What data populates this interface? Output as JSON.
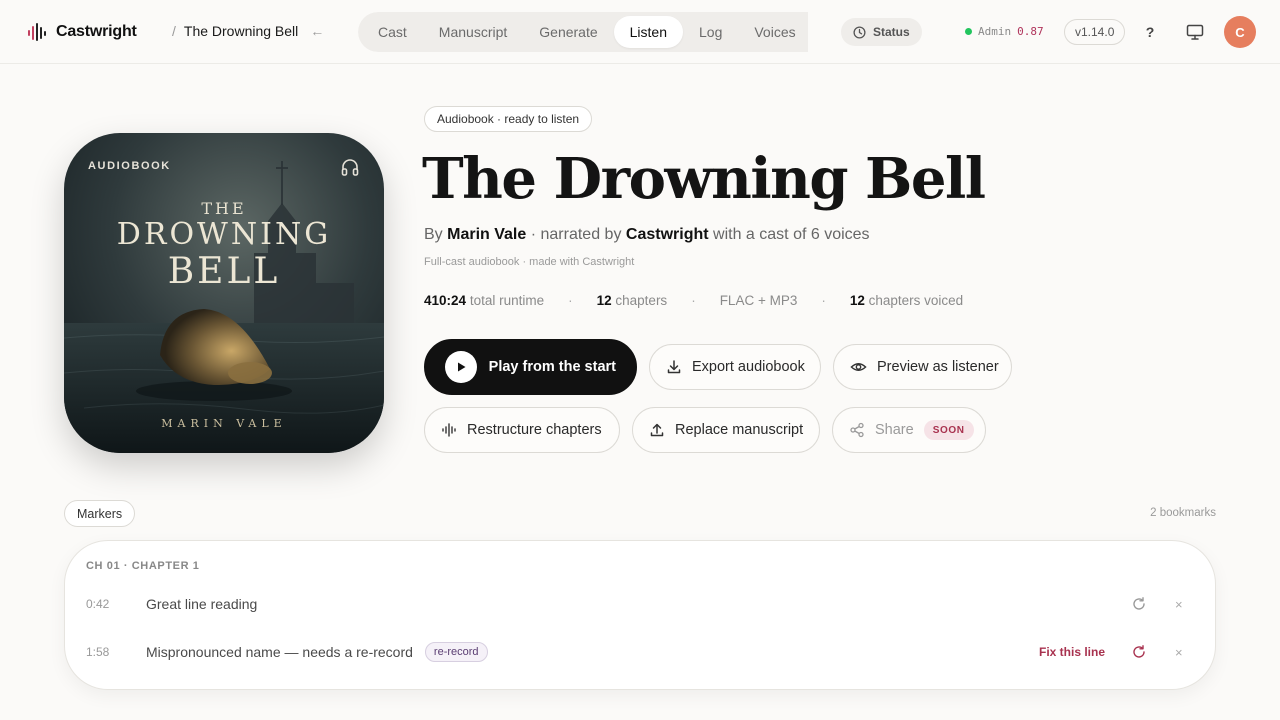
{
  "app": {
    "brand": "Castwright",
    "breadcrumb_sep": "/",
    "breadcrumb_title": "The Drowning Bell",
    "back_glyph": "←"
  },
  "nav": {
    "tabs": [
      {
        "label": "Cast",
        "active": false
      },
      {
        "label": "Manuscript",
        "active": false
      },
      {
        "label": "Generate",
        "active": false
      },
      {
        "label": "Listen",
        "active": true
      },
      {
        "label": "Log",
        "active": false
      },
      {
        "label": "Voices",
        "active": false
      }
    ],
    "status_label": "Status",
    "admin_label": "Admin",
    "admin_value": "0.87",
    "version": "v1.14.0",
    "help_label": "?",
    "avatar_initial": "C"
  },
  "cover": {
    "label": "AUDIOBOOK",
    "title_small": "THE",
    "title_line1": "DROWNING",
    "title_line2": "BELL",
    "author": "MARIN VALE"
  },
  "book": {
    "badge": "Audiobook · ready to listen",
    "title": "The Drowning Bell",
    "by_prefix": "By",
    "author": "Marin Vale",
    "narrated_prefix": "· narrated by",
    "narrator": "Castwright",
    "cast_suffix": "with a cast of 6 voices",
    "subline": "Full-cast audiobook · made with Castwright",
    "stats": {
      "runtime_value": "410:24",
      "runtime_label": "total runtime",
      "chapters_value": "12",
      "chapters_label": "chapters",
      "format": "FLAC + MP3",
      "voiced_value": "12",
      "voiced_label": "chapters voiced",
      "sep": "·"
    }
  },
  "actions": {
    "play": "Play from the start",
    "export": "Export audiobook",
    "preview": "Preview as listener",
    "restructure": "Restructure chapters",
    "replace": "Replace manuscript",
    "share": "Share",
    "soon": "SOON"
  },
  "markers": {
    "chip_label": "Markers",
    "count_label": "2 bookmarks",
    "chapter_heading": "CH 01 · CHAPTER 1",
    "rows": [
      {
        "time": "0:42",
        "text": "Great line reading",
        "tag": "",
        "fix": ""
      },
      {
        "time": "1:58",
        "text": "Mispronounced name — needs a re-record",
        "tag": "re-record",
        "fix": "Fix this line"
      }
    ],
    "close_glyph": "×"
  },
  "colors": {
    "accent": "#a8324f",
    "status_green": "#22c55e",
    "avatar": "#e67e5e",
    "primary_button": "#111111"
  }
}
